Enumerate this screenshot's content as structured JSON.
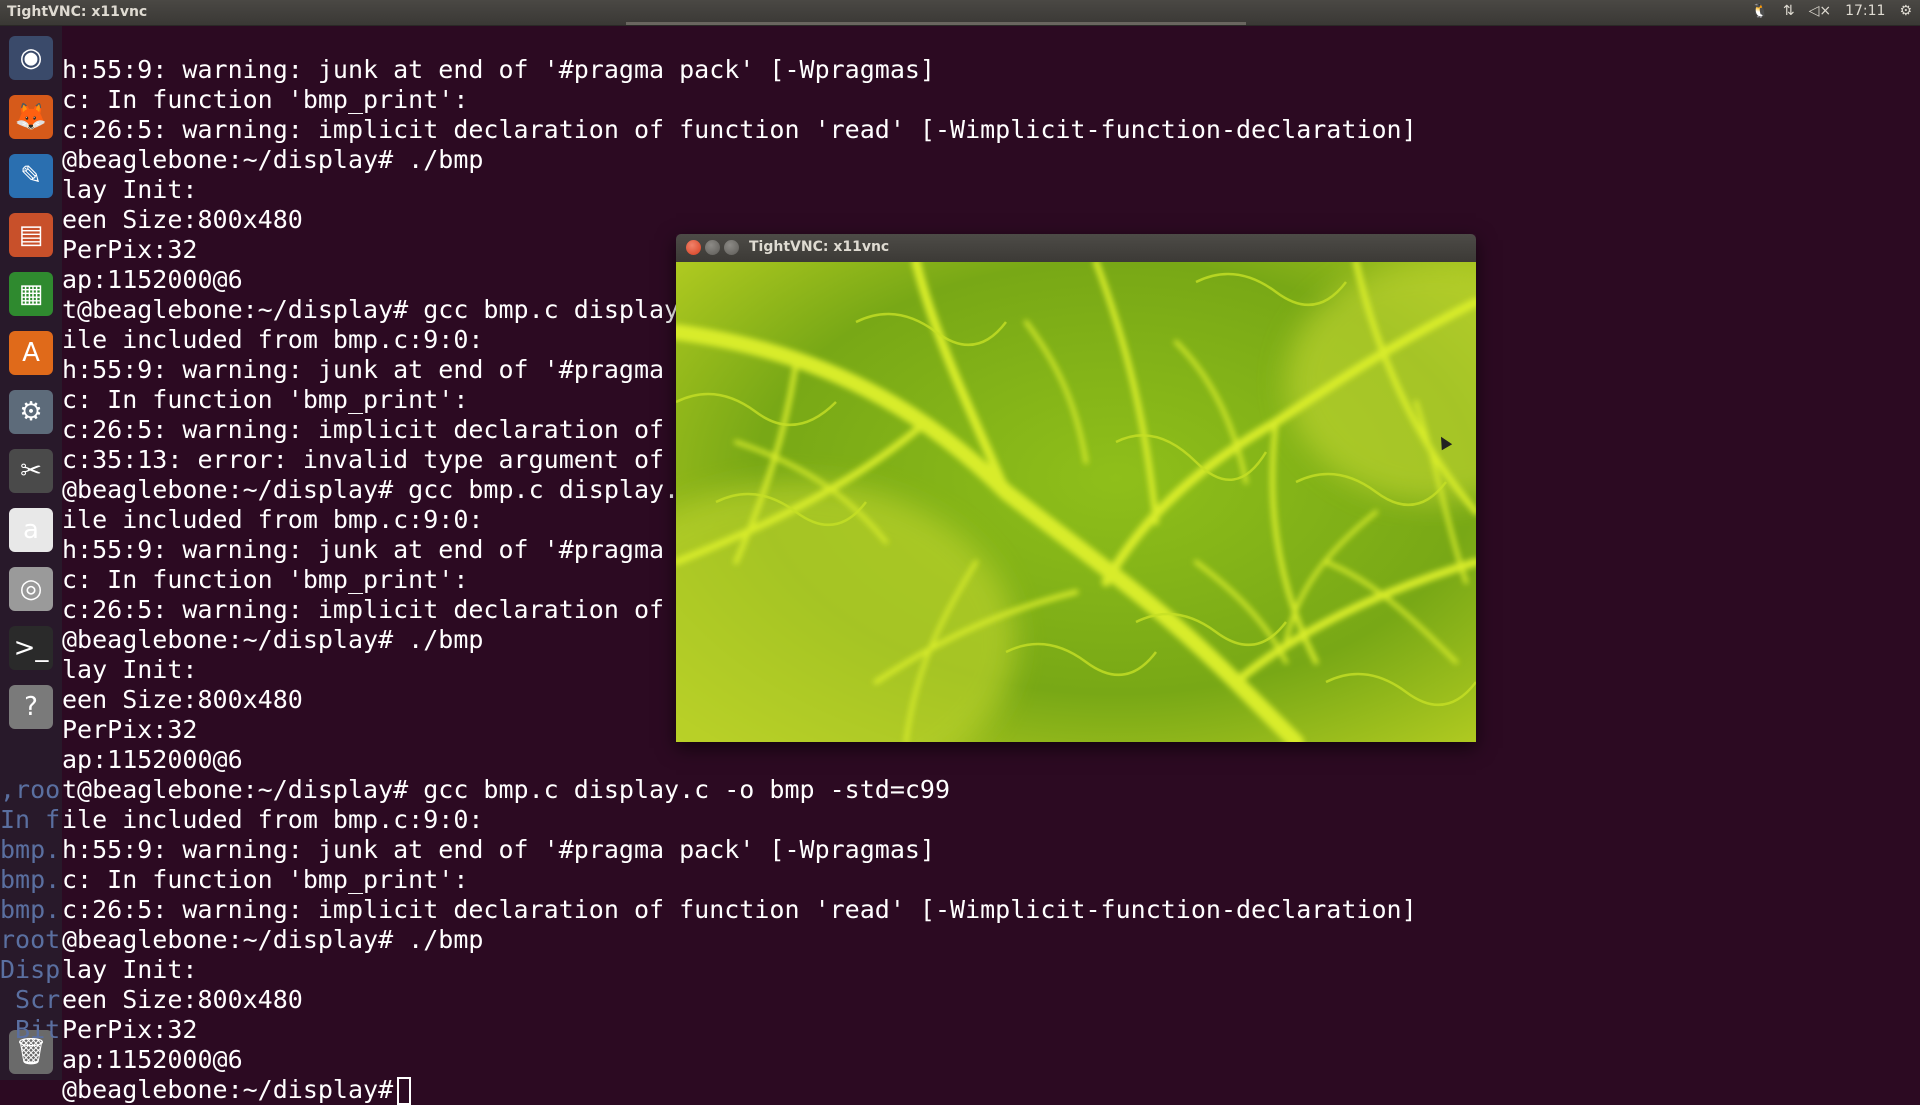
{
  "topbar": {
    "title": "TightVNC: x11vnc",
    "clock": "17:11",
    "tray_icons": [
      "tux-icon",
      "network-icon",
      "volume-muted-icon",
      "gear-icon"
    ]
  },
  "launcher": {
    "items": [
      {
        "name": "ubuntu-dash-icon",
        "glyph": "◉",
        "color": "#3a4a6a"
      },
      {
        "name": "firefox-icon",
        "glyph": "🦊",
        "color": "#d65a1a"
      },
      {
        "name": "writer-icon",
        "glyph": "✎",
        "color": "#2a6fb0"
      },
      {
        "name": "impress-icon",
        "glyph": "▤",
        "color": "#c8502a"
      },
      {
        "name": "calc-icon",
        "glyph": "▦",
        "color": "#2f8a2f"
      },
      {
        "name": "software-center-icon",
        "glyph": "A",
        "color": "#e06a1a"
      },
      {
        "name": "system-settings-icon",
        "glyph": "⚙",
        "color": "#5d6b7a"
      },
      {
        "name": "tools-icon",
        "glyph": "✂",
        "color": "#4a4a4a"
      },
      {
        "name": "amazon-icon",
        "glyph": "a",
        "color": "#e8e8e8"
      },
      {
        "name": "dvd-icon",
        "glyph": "◎",
        "color": "#9a9a9a"
      },
      {
        "name": "terminal-icon",
        "glyph": ">_",
        "color": "#2a2a2a"
      },
      {
        "name": "help-icon",
        "glyph": "?",
        "color": "#7a7a7a"
      },
      {
        "name": "trash-icon",
        "glyph": "🗑",
        "color": "#6a6a6a"
      }
    ]
  },
  "terminal": {
    "lines": [
      "h:55:9: warning: junk at end of '#pragma pack' [-Wpragmas]",
      "c: In function 'bmp_print':",
      "c:26:5: warning: implicit declaration of function 'read' [-Wimplicit-function-declaration]",
      "@beaglebone:~/display# ./bmp",
      "lay Init:",
      "een Size:800x480",
      "PerPix:32",
      "ap:1152000@6",
      "t@beaglebone:~/display# gcc bmp.c display",
      "ile included from bmp.c:9:0:",
      "h:55:9: warning: junk at end of '#pragma",
      "c: In function 'bmp_print':",
      "c:26:5: warning: implicit declaration of",
      "c:35:13: error: invalid type argument of",
      "@beaglebone:~/display# gcc bmp.c display.",
      "ile included from bmp.c:9:0:",
      "h:55:9: warning: junk at end of '#pragma",
      "c: In function 'bmp_print':",
      "c:26:5: warning: implicit declaration of",
      "@beaglebone:~/display# ./bmp",
      "lay Init:",
      "een Size:800x480",
      "PerPix:32",
      "ap:1152000@6",
      "t@beaglebone:~/display# gcc bmp.c display.c -o bmp -std=c99",
      "ile included from bmp.c:9:0:",
      "h:55:9: warning: junk at end of '#pragma pack' [-Wpragmas]",
      "c: In function 'bmp_print':",
      "c:26:5: warning: implicit declaration of function 'read' [-Wimplicit-function-declaration]",
      "@beaglebone:~/display# ./bmp",
      "lay Init:",
      "een Size:800x480",
      "PerPix:32",
      "ap:1152000@6",
      "@beaglebone:~/display#"
    ],
    "underlay": [
      {
        "line": 24,
        "text": ",roo"
      },
      {
        "line": 25,
        "text": "In f"
      },
      {
        "line": 26,
        "text": "bmp."
      },
      {
        "line": 27,
        "text": "bmp."
      },
      {
        "line": 28,
        "text": "bmp."
      },
      {
        "line": 29,
        "text": "root"
      },
      {
        "line": 30,
        "text": "Disp"
      },
      {
        "line": 31,
        "text": " Scr"
      },
      {
        "line": 32,
        "text": " Bit"
      }
    ]
  },
  "vnc_window": {
    "title": "TightVNC: x11vnc",
    "image_name": "green-leaf-wallpaper"
  }
}
